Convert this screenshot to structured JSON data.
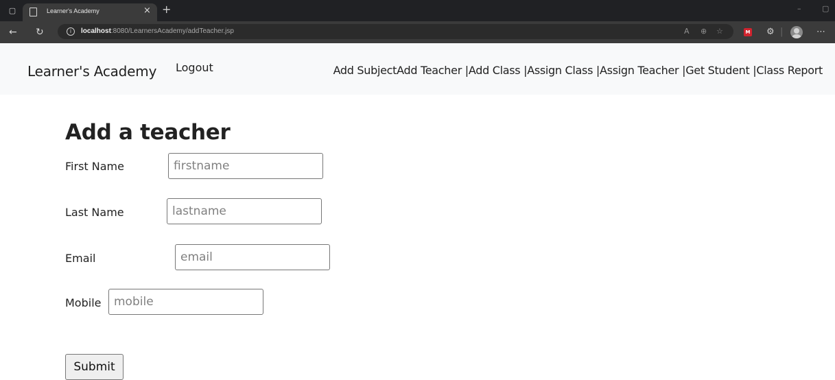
{
  "browser": {
    "tab_title": "Learner's Academy",
    "url_host": "localhost",
    "url_rest": ":8080/LearnersAcademy/addTeacher.jsp"
  },
  "navbar": {
    "brand": "Learner's Academy",
    "logout": "Logout",
    "links": [
      "Add Subject",
      "Add Teacher |",
      "Add Class |",
      "Assign Class |",
      "Assign Teacher |",
      "Get Student |",
      "Class Report"
    ]
  },
  "form": {
    "title": "Add a teacher",
    "first_name": {
      "label": "First Name",
      "placeholder": "firstname",
      "value": ""
    },
    "last_name": {
      "label": "Last Name",
      "placeholder": "lastname",
      "value": ""
    },
    "email": {
      "label": "Email",
      "placeholder": "email",
      "value": ""
    },
    "mobile": {
      "label": "Mobile",
      "placeholder": "mobile",
      "value": ""
    },
    "submit_label": "Submit"
  }
}
